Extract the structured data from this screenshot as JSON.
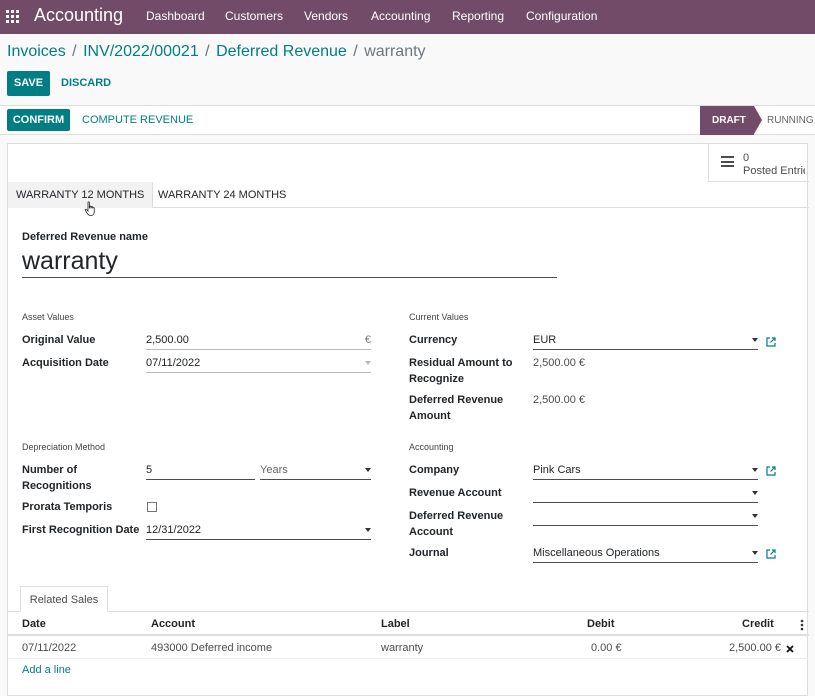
{
  "nav": {
    "app_title": "Accounting",
    "menu": [
      "Dashboard",
      "Customers",
      "Vendors",
      "Accounting",
      "Reporting",
      "Configuration"
    ]
  },
  "breadcrumb": {
    "items": [
      "Invoices",
      "INV/2022/00021",
      "Deferred Revenue"
    ],
    "current": "warranty",
    "sep": "/"
  },
  "actions": {
    "save": "SAVE",
    "discard": "DISCARD"
  },
  "header_buttons": {
    "confirm": "CONFIRM",
    "compute": "COMPUTE REVENUE"
  },
  "status": {
    "stages": [
      "DRAFT",
      "RUNNING"
    ],
    "active": "DRAFT"
  },
  "smart_button": {
    "value": "0",
    "label": "Posted Entries"
  },
  "model_tabs": [
    "WARRANTY 12 MONTHS",
    "WARRANTY 24 MONTHS"
  ],
  "name_label": "Deferred Revenue name",
  "name_value": "warranty",
  "asset_values": {
    "title": "Asset Values",
    "original_value_label": "Original Value",
    "original_value": "2,500.00",
    "currency_symbol": "€",
    "acquisition_date_label": "Acquisition Date",
    "acquisition_date": "07/11/2022"
  },
  "current_values": {
    "title": "Current Values",
    "currency_label": "Currency",
    "currency": "EUR",
    "residual_label_1": "Residual Amount to",
    "residual_label_2": "Recognize",
    "residual": "2,500.00 €",
    "deferred_amount_label_1": "Deferred Revenue",
    "deferred_amount_label_2": "Amount",
    "deferred_amount": "2,500.00 €"
  },
  "depreciation": {
    "title": "Depreciation Method",
    "num_label_1": "Number of",
    "num_label_2": "Recognitions",
    "num": "5",
    "period": "Years",
    "prorata_label": "Prorata Temporis",
    "prorata_checked": false,
    "first_date_label": "First Recognition Date",
    "first_date": "12/31/2022"
  },
  "accounting": {
    "title": "Accounting",
    "company_label": "Company",
    "company": "Pink Cars",
    "revenue_account_label": "Revenue Account",
    "revenue_account": "",
    "deferred_account_label_1": "Deferred Revenue",
    "deferred_account_label_2": "Account",
    "deferred_account": "",
    "journal_label": "Journal",
    "journal": "Miscellaneous Operations"
  },
  "related_sales": {
    "tab_label": "Related Sales",
    "columns": [
      "Date",
      "Account",
      "Label",
      "Debit",
      "Credit"
    ],
    "rows": [
      {
        "date": "07/11/2022",
        "account": "493000 Deferred income",
        "label": "warranty",
        "debit": "0.00 €",
        "credit": "2,500.00 €"
      }
    ],
    "add_line": "Add a line"
  },
  "colors": {
    "brand": "#714b67",
    "primary": "#017e84"
  }
}
